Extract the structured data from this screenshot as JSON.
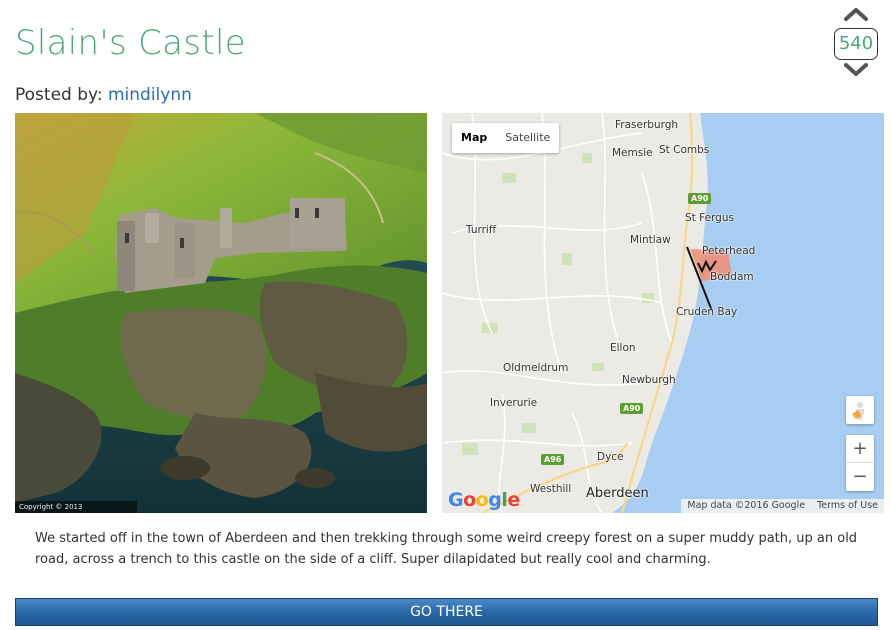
{
  "post": {
    "title": "Slain's Castle",
    "posted_by_label": "Posted by:",
    "author": "mindilynn",
    "description": "We started off in the town of Aberdeen and then trekking through some weird creepy forest on a super muddy path, up an old road, across a trench to this castle on the side of a cliff. Super dilapidated but really cool and charming.",
    "go_button": "GO THERE"
  },
  "vote": {
    "count": "540",
    "up_icon": "chevron-up-icon",
    "down_icon": "chevron-down-icon"
  },
  "photo": {
    "copyright": "Copyright © 2013"
  },
  "map": {
    "map_type_map": "Map",
    "map_type_satellite": "Satellite",
    "zoom_in": "+",
    "zoom_out": "−",
    "attribution": "Map data ©2016 Google",
    "terms": "Terms of Use",
    "logo": "Google",
    "places": {
      "fraserburgh": "Fraserburgh",
      "memsie": "Memsie",
      "st_combs": "St Combs",
      "st_fergus": "St Fergus",
      "turriff": "Turriff",
      "mintlaw": "Mintlaw",
      "peterhead": "Peterhead",
      "boddam": "Boddam",
      "cruden_bay": "Cruden Bay",
      "ellon": "Ellon",
      "oldmeldrum": "Oldmeldrum",
      "newburgh": "Newburgh",
      "inverurie": "Inverurie",
      "dyce": "Dyce",
      "westhill": "Westhill",
      "aberdeen": "Aberdeen"
    },
    "roads": {
      "a90_north": "A90",
      "a90_south": "A90",
      "a96": "A96"
    },
    "colors": {
      "sea": "#a7cdf2",
      "land": "#eceae4",
      "marker": "#f08c72"
    }
  },
  "colors": {
    "title": "#4fa877",
    "link": "#2a6fb0",
    "button": "#2a68a8"
  }
}
